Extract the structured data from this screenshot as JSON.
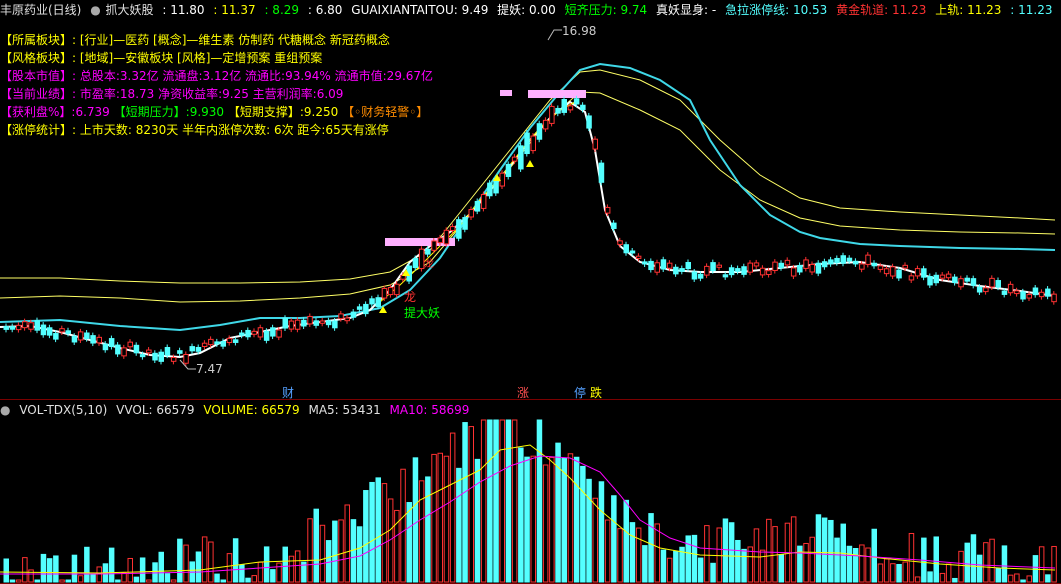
{
  "header": {
    "title": "丰原药业(日线)",
    "indicator_icon": "circle-icon",
    "indicator_name": "抓大妖股",
    "v1": ": 11.80",
    "v2": ": 11.37",
    "v3": ": 8.29",
    "v4": ": 6.80",
    "gx_label": "GUAIXIANTAITOU:",
    "gx_value": "9.49",
    "tiyao_label": "提妖:",
    "tiyao_value": "0.00",
    "dqyl_label": "短齐压力:",
    "dqyl_value": "9.74",
    "zyxs_label": "真妖显身:",
    "zyxs_value": "-",
    "jlztx_label": "急拉涨停线:",
    "jlztx_value": "10.53",
    "hjgd_label": "黄金轨道:",
    "hjgd_value": "11.23",
    "sg_label": "上轨:",
    "sg_value": "11.23",
    "last_value": ": 11.23"
  },
  "info": {
    "row1_label": "【所属板块】:",
    "row1_value": "[行业]—医药 [概念]—维生素 仿制药 代糖概念 新冠药概念",
    "row2_label": "【风格板块】:",
    "row2_value": "[地域]—安徽板块 [风格]—定增预案 重组预案",
    "row3_label": "【股本市值】:",
    "row3_value": "总股本:3.32亿 流通盘:3.12亿 流通比:93.94% 流通市值:29.67亿",
    "row4_label": "【当前业绩】:",
    "row4_value": "市盈率:18.73 净资收益率:9.25 主营利润率:6.09",
    "row5_a": "【获利盘%】:",
    "row5_b": "6.739",
    "row5_c": "【短期压力】:",
    "row5_d": "9.930",
    "row5_e": "【短期支撑】:",
    "row5_f": "9.250",
    "row5_g": "【◦财务轻警◦】",
    "row6_label": "【涨停统计】:",
    "row6_value": "上市天数: 8230天 半年内涨停次数: 6次   距今:65天有涨停"
  },
  "annotations": {
    "high": "16.98",
    "low": "7.47",
    "dragon": "龙",
    "dragon2": "龙",
    "tiyao": "提大妖",
    "cai": "财",
    "zhang": "涨",
    "ting": "停",
    "die": "跌"
  },
  "volume_header": {
    "name": "VOL-TDX(5,10)",
    "vvol": "VVOL: 66579",
    "volume": "VOLUME: 66579",
    "ma5": "MA5: 53431",
    "ma10": "MA10: 58699"
  },
  "colors": {
    "up": "#ff3232",
    "down": "#54ffff",
    "yellow": "#ffff00",
    "magenta": "#ff00ff",
    "white": "#ffffff",
    "green": "#00ff00",
    "pink": "#ffb0ff",
    "cyan_line": "#3fd8e8"
  }
}
